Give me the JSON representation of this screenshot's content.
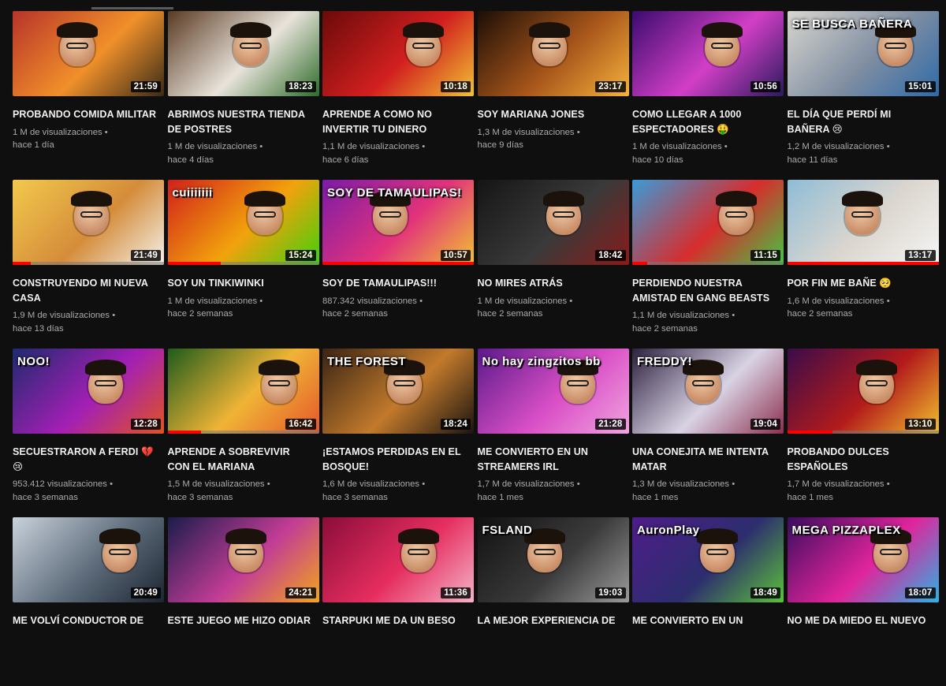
{
  "videos": [
    {
      "title": "PROBANDO COMIDA MILITAR",
      "views": "1 M de visualizaciones",
      "age": "hace 1 día",
      "duration": "21:59",
      "progress": 0,
      "thumb_text": "",
      "colors": [
        "#b8332b",
        "#f0902a",
        "#3a2a18"
      ]
    },
    {
      "title": "ABRIMOS NUESTRA TIENDA DE POSTRES",
      "views": "1 M de visualizaciones",
      "age": "hace 4 días",
      "duration": "18:23",
      "progress": 0,
      "thumb_text": "",
      "colors": [
        "#5a3a22",
        "#e8e3da",
        "#2f6b2b"
      ]
    },
    {
      "title": "APRENDE A COMO NO INVERTIR TU DINERO",
      "views": "1,1 M de visualizaciones",
      "age": "hace 6 días",
      "duration": "10:18",
      "progress": 0,
      "thumb_text": "",
      "colors": [
        "#6b0a0a",
        "#d21f1f",
        "#f1c232"
      ]
    },
    {
      "title": "SOY MARIANA JONES",
      "views": "1,3 M de visualizaciones",
      "age": "hace 9 días",
      "duration": "23:17",
      "progress": 0,
      "thumb_text": "",
      "colors": [
        "#1c0e06",
        "#a8561b",
        "#f5b23c"
      ]
    },
    {
      "title": "COMO LLEGAR A 1000 ESPECTADORES 🤑",
      "views": "1 M de visualizaciones",
      "age": "hace 10 días",
      "duration": "10:56",
      "progress": 0,
      "thumb_text": "",
      "colors": [
        "#3a0b6e",
        "#d23fc7",
        "#2a1a5c"
      ]
    },
    {
      "title": "EL DÍA QUE PERDÍ MI BAÑERA 😢",
      "views": "1,2 M de visualizaciones",
      "age": "hace 11 días",
      "duration": "15:01",
      "progress": 0,
      "thumb_text": "SE BUSCA BAÑERA",
      "colors": [
        "#d9d6cf",
        "#7f8ea2",
        "#2e6aa8"
      ]
    },
    {
      "title": "CONSTRUYENDO MI NUEVA CASA",
      "views": "1,9 M de visualizaciones",
      "age": "hace 13 días",
      "duration": "21:49",
      "progress": 12,
      "thumb_text": "",
      "colors": [
        "#f2c94c",
        "#d58c3a",
        "#f4f1e9"
      ]
    },
    {
      "title": "SOY UN TINKIWINKI",
      "views": "1 M de visualizaciones",
      "age": "hace 2 semanas",
      "duration": "15:24",
      "progress": 35,
      "thumb_text": "cuiiiiiii",
      "colors": [
        "#d1201a",
        "#f2a20d",
        "#3fd10b"
      ]
    },
    {
      "title": "SOY DE TAMAULIPAS!!!",
      "views": "887.342 visualizaciones",
      "age": "hace 2 semanas",
      "duration": "10:57",
      "progress": 100,
      "thumb_text": "SOY DE TAMAULIPAS!",
      "colors": [
        "#7b1ba8",
        "#e2337b",
        "#f1c232"
      ]
    },
    {
      "title": "NO MIRES ATRÁS",
      "views": "1 M de visualizaciones",
      "age": "hace 2 semanas",
      "duration": "18:42",
      "progress": 0,
      "thumb_text": "",
      "colors": [
        "#151515",
        "#3a3a3a",
        "#8a1a1a"
      ]
    },
    {
      "title": "PERDIENDO NUESTRA AMISTAD EN GANG BEASTS",
      "views": "1,1 M de visualizaciones",
      "age": "hace 2 semanas",
      "duration": "11:15",
      "progress": 10,
      "thumb_text": "",
      "colors": [
        "#3a9bd8",
        "#d62d2d",
        "#45c442"
      ]
    },
    {
      "title": "POR FIN ME BAÑE 🥺",
      "views": "1,6 M de visualizaciones",
      "age": "hace 2 semanas",
      "duration": "13:17",
      "progress": 100,
      "thumb_text": "",
      "colors": [
        "#8fbcd6",
        "#dcd7cf",
        "#f5f5f5"
      ]
    },
    {
      "title": "SECUESTRARON A FERDI 💔 😢",
      "views": "953.412 visualizaciones",
      "age": "hace 3 semanas",
      "duration": "12:28",
      "progress": 0,
      "thumb_text": "NOO!",
      "colors": [
        "#1e2a6e",
        "#a31fb5",
        "#e0541f"
      ]
    },
    {
      "title": "APRENDE A SOBREVIVIR CON EL MARIANA",
      "views": "1,5 M de visualizaciones",
      "age": "hace 3 semanas",
      "duration": "16:42",
      "progress": 22,
      "thumb_text": "",
      "colors": [
        "#1f5b1c",
        "#f0b436",
        "#e4562a"
      ]
    },
    {
      "title": "¡ESTAMOS PERDIDAS EN EL BOSQUE!",
      "views": "1,6 M de visualizaciones",
      "age": "hace 3 semanas",
      "duration": "18:24",
      "progress": 0,
      "thumb_text": "THE FOREST",
      "colors": [
        "#3a2414",
        "#c27a2c",
        "#1b1410"
      ]
    },
    {
      "title": "ME CONVIERTO EN UN STREAMERS IRL",
      "views": "1,7 M de visualizaciones",
      "age": "hace 1 mes",
      "duration": "21:28",
      "progress": 0,
      "thumb_text": "No hay zingzitos bb",
      "colors": [
        "#5b1a8a",
        "#d94fc6",
        "#f1a3e0"
      ]
    },
    {
      "title": "UNA CONEJITA ME INTENTA MATAR",
      "views": "1,3 M de visualizaciones",
      "age": "hace 1 mes",
      "duration": "19:04",
      "progress": 0,
      "thumb_text": "FREDDY!",
      "colors": [
        "#2d2140",
        "#d9d3e4",
        "#8b2f4f"
      ]
    },
    {
      "title": "PROBANDO DULCES ESPAÑOLES",
      "views": "1,7 M de visualizaciones",
      "age": "hace 1 mes",
      "duration": "13:10",
      "progress": 30,
      "thumb_text": "",
      "colors": [
        "#3a0c4a",
        "#b31b1b",
        "#f2c12e"
      ]
    },
    {
      "title": "ME VOLVÍ CONDUCTOR DE",
      "views": "",
      "age": "",
      "duration": "20:49",
      "progress": 0,
      "thumb_text": "",
      "colors": [
        "#c9d2dc",
        "#5d6b7a",
        "#1c2631"
      ]
    },
    {
      "title": "ESTE JUEGO ME HIZO ODIAR",
      "views": "",
      "age": "",
      "duration": "24:21",
      "progress": 0,
      "thumb_text": "",
      "colors": [
        "#1b1d4a",
        "#c23c96",
        "#f2a51a"
      ]
    },
    {
      "title": "STARPUKI ME DA UN BESO",
      "views": "",
      "age": "",
      "duration": "11:36",
      "progress": 0,
      "thumb_text": "",
      "colors": [
        "#8a0d3a",
        "#e62e5f",
        "#f5b3c8"
      ]
    },
    {
      "title": "LA MEJOR EXPERIENCIA DE",
      "views": "",
      "age": "",
      "duration": "19:03",
      "progress": 0,
      "thumb_text": "FSLAND",
      "colors": [
        "#111111",
        "#3b3b3b",
        "#9a9a9a"
      ]
    },
    {
      "title": "ME CONVIERTO EN UN",
      "views": "",
      "age": "",
      "duration": "18:49",
      "progress": 0,
      "thumb_text": "AuronPlay",
      "colors": [
        "#4d1d89",
        "#2d2d6e",
        "#5bc23a"
      ]
    },
    {
      "title": "NO ME DA MIEDO EL NUEVO",
      "views": "",
      "age": "",
      "duration": "18:07",
      "progress": 0,
      "thumb_text": "MEGA PIZZAPLEX",
      "colors": [
        "#3a0d5e",
        "#e0249b",
        "#2bb3e3"
      ]
    }
  ]
}
